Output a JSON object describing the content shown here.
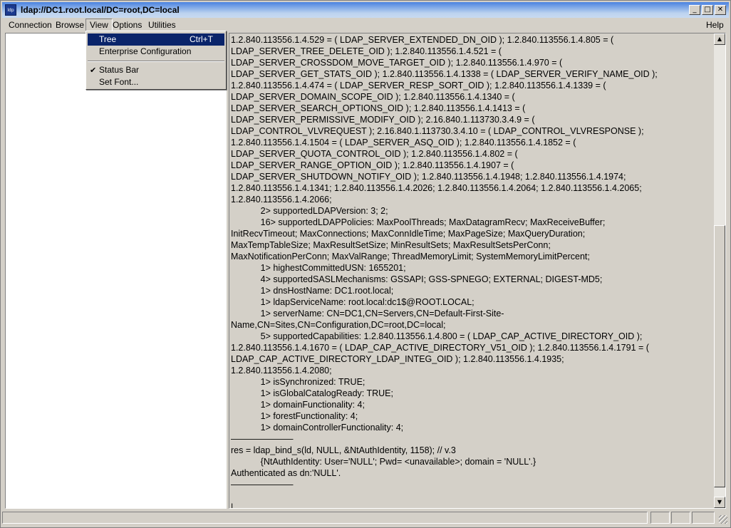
{
  "window": {
    "title": "ldap://DC1.root.local/DC=root,DC=local",
    "icon_label": "ldp",
    "controls": {
      "minimize": "_",
      "maximize": "□",
      "close": "✕"
    }
  },
  "menubar": {
    "connection": "Connection",
    "browse": "Browse",
    "view": "View",
    "options": "Options",
    "utilities": "Utilities",
    "help": "Help"
  },
  "view_menu": {
    "tree": {
      "label": "Tree",
      "accel": "Ctrl+T"
    },
    "enterprise_configuration": "Enterprise Configuration",
    "status_bar": {
      "label": "Status Bar",
      "checked": true,
      "check_glyph": "✔"
    },
    "set_font": "Set Font..."
  },
  "output": {
    "lines": [
      "1.2.840.113556.1.4.529 = ( LDAP_SERVER_EXTENDED_DN_OID ); 1.2.840.113556.1.4.805 = (",
      "LDAP_SERVER_TREE_DELETE_OID ); 1.2.840.113556.1.4.521 = (",
      "LDAP_SERVER_CROSSDOM_MOVE_TARGET_OID ); 1.2.840.113556.1.4.970 = (",
      "LDAP_SERVER_GET_STATS_OID ); 1.2.840.113556.1.4.1338 = ( LDAP_SERVER_VERIFY_NAME_OID );",
      "1.2.840.113556.1.4.474 = ( LDAP_SERVER_RESP_SORT_OID ); 1.2.840.113556.1.4.1339 = (",
      "LDAP_SERVER_DOMAIN_SCOPE_OID ); 1.2.840.113556.1.4.1340 = (",
      "LDAP_SERVER_SEARCH_OPTIONS_OID ); 1.2.840.113556.1.4.1413 = (",
      "LDAP_SERVER_PERMISSIVE_MODIFY_OID ); 2.16.840.1.113730.3.4.9 = (",
      "LDAP_CONTROL_VLVREQUEST ); 2.16.840.1.113730.3.4.10 = ( LDAP_CONTROL_VLVRESPONSE );",
      "1.2.840.113556.1.4.1504 = ( LDAP_SERVER_ASQ_OID ); 1.2.840.113556.1.4.1852 = (",
      "LDAP_SERVER_QUOTA_CONTROL_OID ); 1.2.840.113556.1.4.802 = (",
      "LDAP_SERVER_RANGE_OPTION_OID ); 1.2.840.113556.1.4.1907 = (",
      "LDAP_SERVER_SHUTDOWN_NOTIFY_OID ); 1.2.840.113556.1.4.1948; 1.2.840.113556.1.4.1974;",
      "1.2.840.113556.1.4.1341; 1.2.840.113556.1.4.2026; 1.2.840.113556.1.4.2064; 1.2.840.113556.1.4.2065;",
      "1.2.840.113556.1.4.2066;",
      "            2> supportedLDAPVersion: 3; 2;",
      "            16> supportedLDAPPolicies: MaxPoolThreads; MaxDatagramRecv; MaxReceiveBuffer;",
      "InitRecvTimeout; MaxConnections; MaxConnIdleTime; MaxPageSize; MaxQueryDuration;",
      "MaxTempTableSize; MaxResultSetSize; MinResultSets; MaxResultSetsPerConn;",
      "MaxNotificationPerConn; MaxValRange; ThreadMemoryLimit; SystemMemoryLimitPercent;",
      "            1> highestCommittedUSN: 1655201;",
      "            4> supportedSASLMechanisms: GSSAPI; GSS-SPNEGO; EXTERNAL; DIGEST-MD5;",
      "            1> dnsHostName: DC1.root.local;",
      "            1> ldapServiceName: root.local:dc1$@ROOT.LOCAL;",
      "            1> serverName: CN=DC1,CN=Servers,CN=Default-First-Site-",
      "Name,CN=Sites,CN=Configuration,DC=root,DC=local;",
      "            5> supportedCapabilities: 1.2.840.113556.1.4.800 = ( LDAP_CAP_ACTIVE_DIRECTORY_OID );",
      "1.2.840.113556.1.4.1670 = ( LDAP_CAP_ACTIVE_DIRECTORY_V51_OID ); 1.2.840.113556.1.4.1791 = (",
      "LDAP_CAP_ACTIVE_DIRECTORY_LDAP_INTEG_OID ); 1.2.840.113556.1.4.1935;",
      "1.2.840.113556.1.4.2080;",
      "            1> isSynchronized: TRUE;",
      "            1> isGlobalCatalogReady: TRUE;",
      "            1> domainFunctionality: 4;",
      "            1> forestFunctionality: 4;",
      "            1> domainControllerFunctionality: 4;",
      "———————",
      "res = ldap_bind_s(ld, NULL, &NtAuthIdentity, 1158); // v.3",
      "            {NtAuthIdentity: User='NULL'; Pwd= <unavailable>; domain = 'NULL'.}",
      "Authenticated as dn:'NULL'.",
      "———————",
      "",
      "|"
    ]
  },
  "scrollbar": {
    "up": "▲",
    "down": "▼",
    "position": 0.95
  }
}
